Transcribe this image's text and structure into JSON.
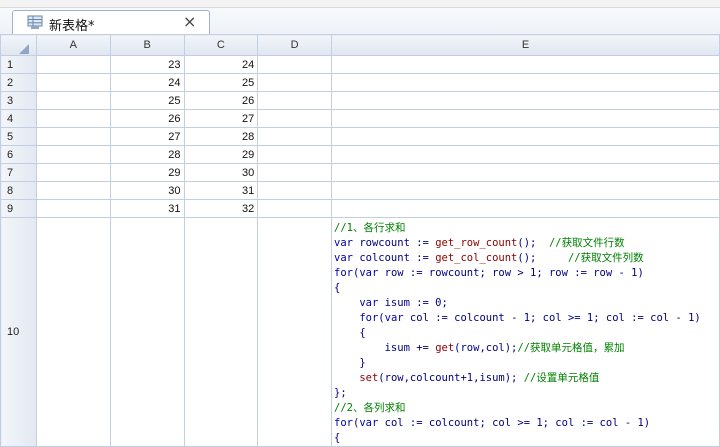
{
  "tab": {
    "title": "新表格*"
  },
  "columns": [
    "A",
    "B",
    "C",
    "D",
    "E"
  ],
  "rows": [
    {
      "n": "1",
      "b": "23",
      "c": "24"
    },
    {
      "n": "2",
      "b": "24",
      "c": "25"
    },
    {
      "n": "3",
      "b": "25",
      "c": "26"
    },
    {
      "n": "4",
      "b": "26",
      "c": "27"
    },
    {
      "n": "5",
      "b": "27",
      "c": "28"
    },
    {
      "n": "6",
      "b": "28",
      "c": "29"
    },
    {
      "n": "7",
      "b": "29",
      "c": "30"
    },
    {
      "n": "8",
      "b": "30",
      "c": "31"
    },
    {
      "n": "9",
      "b": "31",
      "c": "32"
    }
  ],
  "row10": {
    "n": "10"
  },
  "code_lines": [
    [
      {
        "t": "//1、各行求和",
        "c": "cmt"
      }
    ],
    [
      {
        "t": "var ",
        "c": "kw"
      },
      {
        "t": "rowcount := ",
        "c": "txt"
      },
      {
        "t": "get_row_count",
        "c": "fn"
      },
      {
        "t": "();  ",
        "c": "txt"
      },
      {
        "t": "//获取文件行数",
        "c": "cmt"
      }
    ],
    [
      {
        "t": "var ",
        "c": "kw"
      },
      {
        "t": "colcount := ",
        "c": "txt"
      },
      {
        "t": "get_col_count",
        "c": "fn"
      },
      {
        "t": "();     ",
        "c": "txt"
      },
      {
        "t": "//获取文件列数",
        "c": "cmt"
      }
    ],
    [
      {
        "t": "for",
        "c": "kw"
      },
      {
        "t": "(",
        "c": "txt"
      },
      {
        "t": "var ",
        "c": "kw"
      },
      {
        "t": "row := rowcount; row > 1; row := row - 1)",
        "c": "txt"
      }
    ],
    [
      {
        "t": "{",
        "c": "txt"
      }
    ],
    [
      {
        "t": "    var ",
        "c": "kw"
      },
      {
        "t": "isum := 0;",
        "c": "txt"
      }
    ],
    [
      {
        "t": "    for",
        "c": "kw"
      },
      {
        "t": "(",
        "c": "txt"
      },
      {
        "t": "var ",
        "c": "kw"
      },
      {
        "t": "col := colcount - 1; col >= 1; col := col - 1)",
        "c": "txt"
      }
    ],
    [
      {
        "t": "    {",
        "c": "txt"
      }
    ],
    [
      {
        "t": "        isum += ",
        "c": "txt"
      },
      {
        "t": "get",
        "c": "fn"
      },
      {
        "t": "(row,col);",
        "c": "txt"
      },
      {
        "t": "//获取单元格值，累加",
        "c": "cmt"
      }
    ],
    [
      {
        "t": "    }",
        "c": "txt"
      }
    ],
    [
      {
        "t": "    set",
        "c": "fn"
      },
      {
        "t": "(row,colcount+1,isum); ",
        "c": "txt"
      },
      {
        "t": "//设置单元格值",
        "c": "cmt"
      }
    ],
    [
      {
        "t": "};",
        "c": "txt"
      }
    ],
    [
      {
        "t": "//2、各列求和",
        "c": "cmt"
      }
    ],
    [
      {
        "t": "for",
        "c": "kw"
      },
      {
        "t": "(",
        "c": "txt"
      },
      {
        "t": "var ",
        "c": "kw"
      },
      {
        "t": "col := colcount; col >= 1; col := col - 1)",
        "c": "txt"
      }
    ],
    [
      {
        "t": "{",
        "c": "txt"
      }
    ]
  ]
}
